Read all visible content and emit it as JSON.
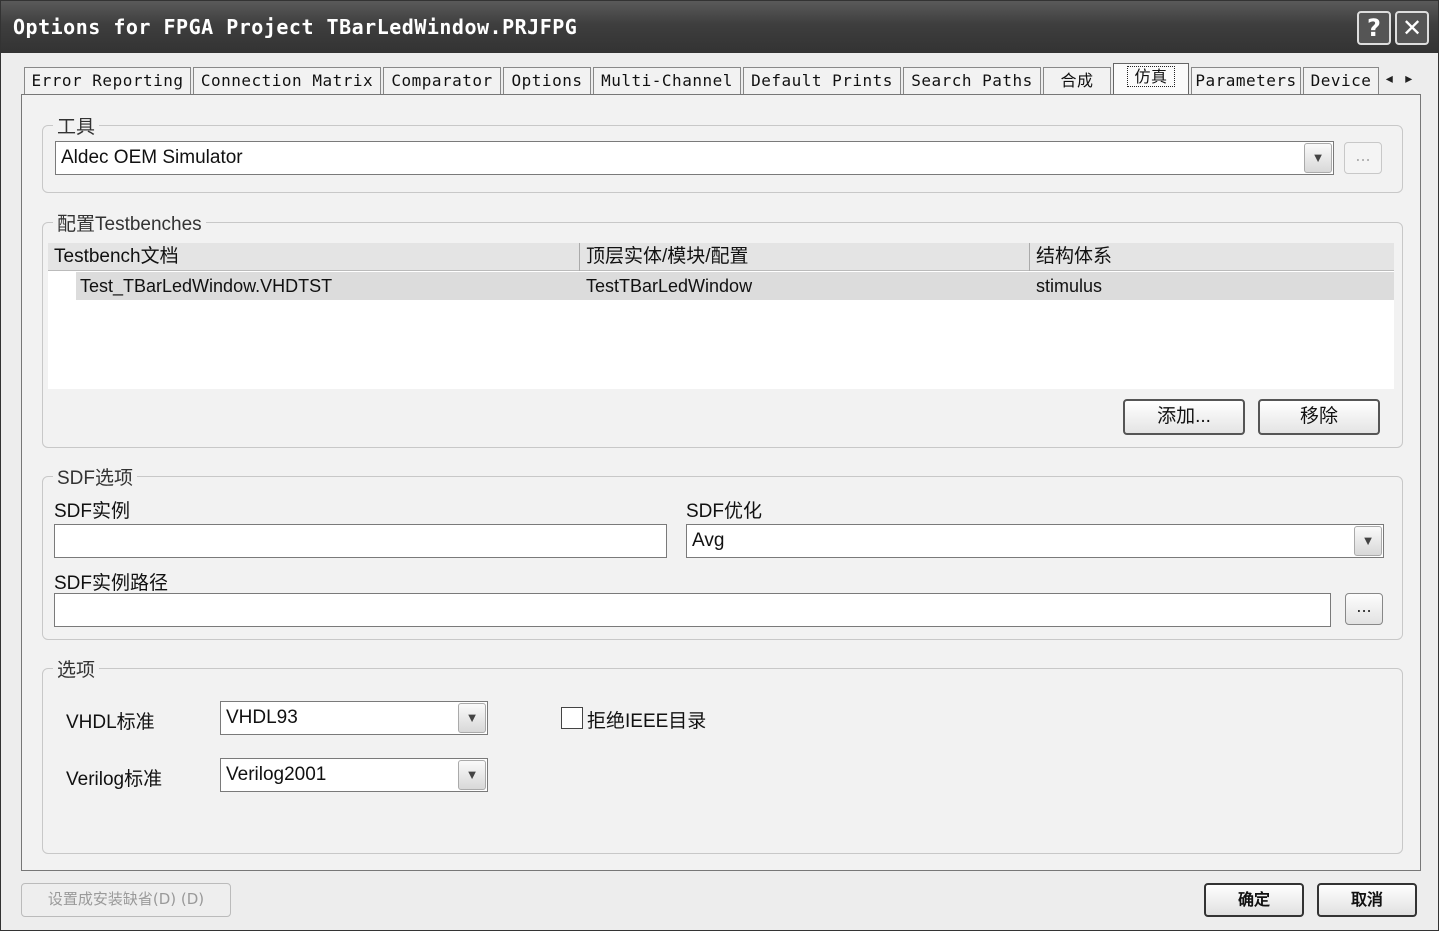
{
  "window": {
    "title": "Options for FPGA Project TBarLedWindow.PRJFPG",
    "help_label": "?",
    "close_label": "✕"
  },
  "tabs": [
    {
      "label": "Error Reporting"
    },
    {
      "label": "Connection Matrix"
    },
    {
      "label": "Comparator"
    },
    {
      "label": "Options"
    },
    {
      "label": "Multi-Channel"
    },
    {
      "label": "Default Prints"
    },
    {
      "label": "Search Paths"
    },
    {
      "label": "合成"
    },
    {
      "label": "仿真",
      "active": true
    },
    {
      "label": "Parameters"
    },
    {
      "label": "Device"
    }
  ],
  "tab_scroll": {
    "left": "◂",
    "right": "▸"
  },
  "tool_group": {
    "label": "工具",
    "selected": "Aldec OEM Simulator",
    "browse_label": "..."
  },
  "testbench_group": {
    "label": "配置Testbenches",
    "columns": [
      "Testbench文档",
      "顶层实体/模块/配置",
      "结构体系"
    ],
    "rows": [
      {
        "document": "Test_TBarLedWindow.VHDTST",
        "top_entity": "TestTBarLedWindow",
        "architecture": "stimulus"
      }
    ],
    "add_label": "添加...",
    "remove_label": "移除"
  },
  "sdf_group": {
    "label": "SDF选项",
    "instance_label": "SDF实例",
    "instance_value": "",
    "optimize_label": "SDF优化",
    "optimize_value": "Avg",
    "path_label": "SDF实例路径",
    "path_value": "",
    "browse_label": "..."
  },
  "options_group": {
    "label": "选项",
    "vhdl_label": "VHDL标准",
    "vhdl_value": "VHDL93",
    "verilog_label": "Verilog标准",
    "verilog_value": "Verilog2001",
    "reject_ieee_label": "拒绝IEEE目录",
    "reject_ieee_checked": false
  },
  "footer": {
    "set_default_label": "设置成安装缺省(D)  (D)",
    "ok_label": "确定",
    "cancel_label": "取消"
  },
  "colors": {
    "titlebar": "#3e3e3e",
    "panel": "#f2f2f2",
    "selected_row": "#dcdcdc"
  }
}
